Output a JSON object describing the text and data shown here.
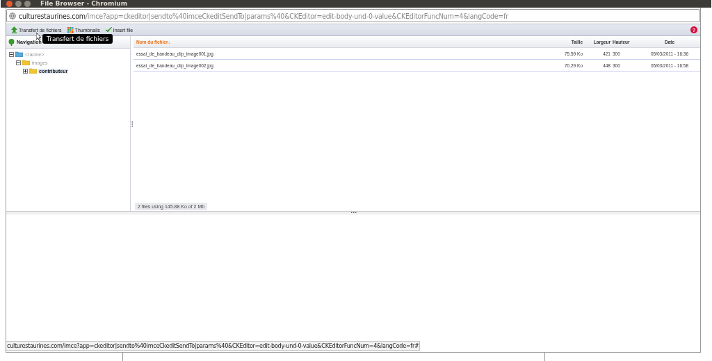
{
  "window": {
    "title": "File Browser - Chromium"
  },
  "address": {
    "domain": "culturestaurines.com",
    "path": "/imce?app=ckeditor|sendto%40imceCkeditSendTo|params%40&CKEditor=edit-body-und-0-value&CKEditorFuncNum=4&langCode=fr"
  },
  "toolbar": {
    "buttons": [
      {
        "label": "Transfert de fichiers",
        "kind": "upload"
      },
      {
        "label": "Thumbnails",
        "kind": "thumbs"
      },
      {
        "label": "Insert file",
        "kind": "insert"
      }
    ],
    "help": "?"
  },
  "tooltip": "Transfert de fichiers",
  "navigation": {
    "title": "Navigation",
    "tree": [
      {
        "label": "<racine>",
        "expanded": true,
        "selected": false,
        "children": [
          {
            "label": "images",
            "expanded": true,
            "selected": false,
            "children": [
              {
                "label": "contributeur",
                "expanded": false,
                "selected": true
              }
            ]
          }
        ]
      }
    ]
  },
  "table": {
    "columns": [
      "Nom du fichier↓",
      "Taille",
      "Largeur",
      "Hauteur",
      "Date"
    ],
    "rows": [
      [
        "essai_de_bandeau_clip_image001.jpg",
        "75.59 Ko",
        "421",
        "300",
        "05/03/2011 - 16:36"
      ],
      [
        "essai_de_bandeau_clip_image002.jpg",
        "70.29 Ko",
        "448",
        "300",
        "05/03/2011 - 16:58"
      ]
    ]
  },
  "summary": "2 files using 145.88 Ko of 2 Mb",
  "status_bar": "culturestaurines.com/imce?app=ckeditor|sendto%40imceCkeditSendTo|params%40&CKEditor=edit-body-und-0-value&CKEditorFuncNum=4&langCode=fr#"
}
